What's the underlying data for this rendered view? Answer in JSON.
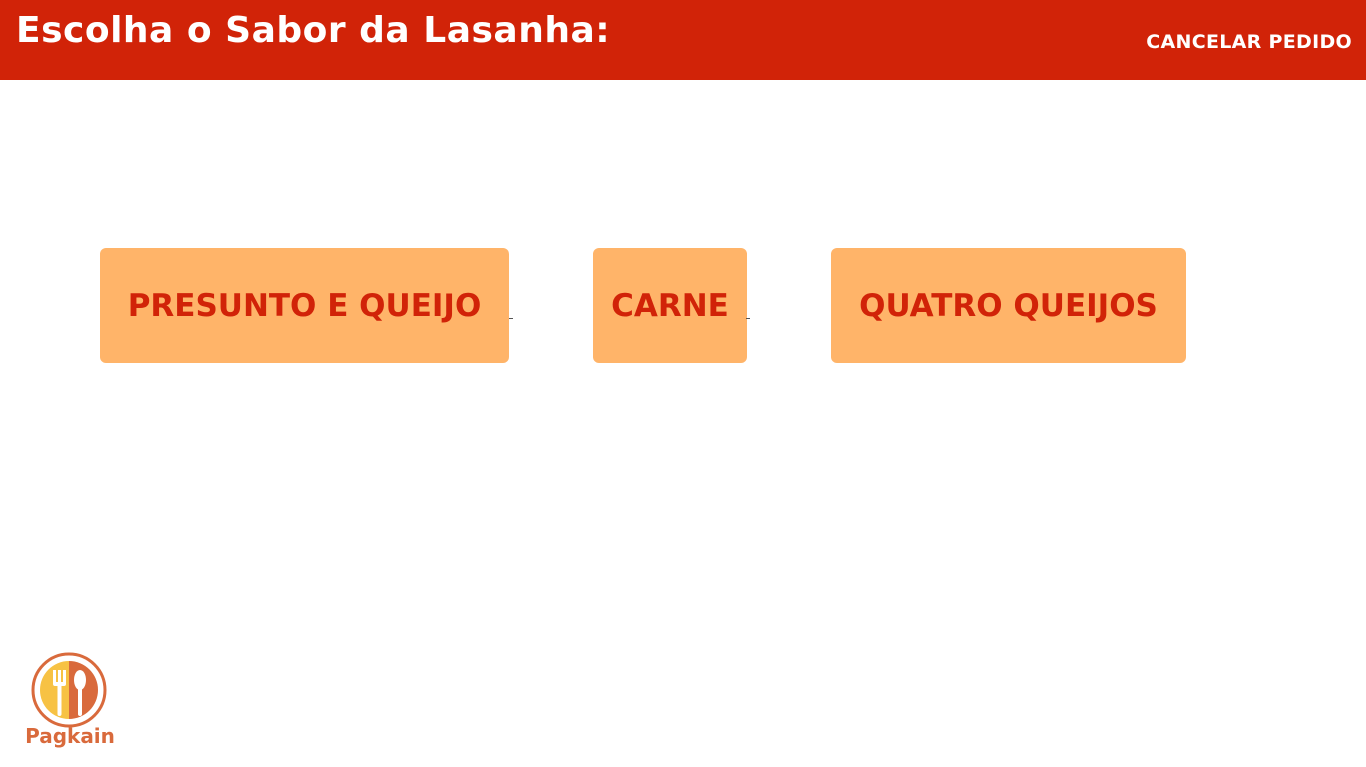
{
  "header": {
    "title": "Escolha o Sabor da Lasanha:",
    "cancel_label": "CANCELAR PEDIDO"
  },
  "options": [
    {
      "label": "PRESUNTO E QUEIJO"
    },
    {
      "label": "CARNE"
    },
    {
      "label": "QUATRO QUEIJOS"
    }
  ],
  "logo": {
    "text": "Pagkain",
    "icon": "fork-spoon-plate-icon"
  },
  "colors": {
    "header_bg": "#d12308",
    "option_bg": "#ffb469",
    "option_text": "#d12308",
    "logo_primary": "#d96a3c",
    "logo_accent": "#f7c244"
  }
}
